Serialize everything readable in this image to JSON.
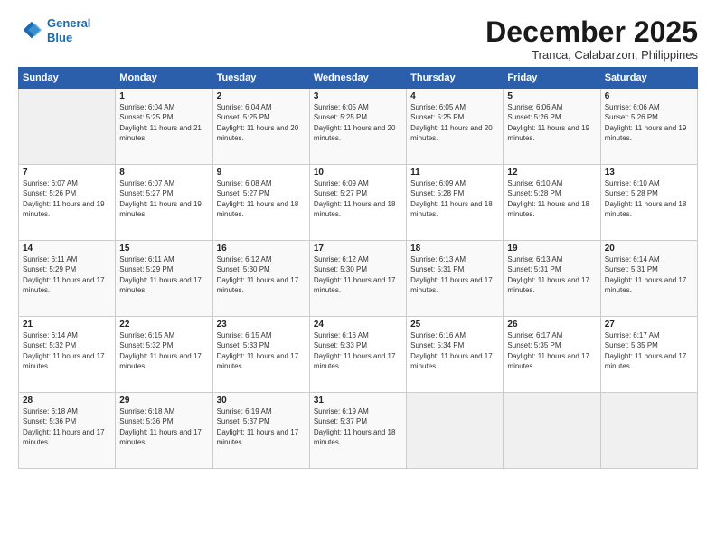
{
  "logo": {
    "line1": "General",
    "line2": "Blue"
  },
  "title": "December 2025",
  "subtitle": "Tranca, Calabarzon, Philippines",
  "header_days": [
    "Sunday",
    "Monday",
    "Tuesday",
    "Wednesday",
    "Thursday",
    "Friday",
    "Saturday"
  ],
  "weeks": [
    [
      {
        "num": "",
        "sunrise": "",
        "sunset": "",
        "daylight": "",
        "empty": true
      },
      {
        "num": "1",
        "sunrise": "Sunrise: 6:04 AM",
        "sunset": "Sunset: 5:25 PM",
        "daylight": "Daylight: 11 hours and 21 minutes."
      },
      {
        "num": "2",
        "sunrise": "Sunrise: 6:04 AM",
        "sunset": "Sunset: 5:25 PM",
        "daylight": "Daylight: 11 hours and 20 minutes."
      },
      {
        "num": "3",
        "sunrise": "Sunrise: 6:05 AM",
        "sunset": "Sunset: 5:25 PM",
        "daylight": "Daylight: 11 hours and 20 minutes."
      },
      {
        "num": "4",
        "sunrise": "Sunrise: 6:05 AM",
        "sunset": "Sunset: 5:25 PM",
        "daylight": "Daylight: 11 hours and 20 minutes."
      },
      {
        "num": "5",
        "sunrise": "Sunrise: 6:06 AM",
        "sunset": "Sunset: 5:26 PM",
        "daylight": "Daylight: 11 hours and 19 minutes."
      },
      {
        "num": "6",
        "sunrise": "Sunrise: 6:06 AM",
        "sunset": "Sunset: 5:26 PM",
        "daylight": "Daylight: 11 hours and 19 minutes."
      }
    ],
    [
      {
        "num": "7",
        "sunrise": "Sunrise: 6:07 AM",
        "sunset": "Sunset: 5:26 PM",
        "daylight": "Daylight: 11 hours and 19 minutes."
      },
      {
        "num": "8",
        "sunrise": "Sunrise: 6:07 AM",
        "sunset": "Sunset: 5:27 PM",
        "daylight": "Daylight: 11 hours and 19 minutes."
      },
      {
        "num": "9",
        "sunrise": "Sunrise: 6:08 AM",
        "sunset": "Sunset: 5:27 PM",
        "daylight": "Daylight: 11 hours and 18 minutes."
      },
      {
        "num": "10",
        "sunrise": "Sunrise: 6:09 AM",
        "sunset": "Sunset: 5:27 PM",
        "daylight": "Daylight: 11 hours and 18 minutes."
      },
      {
        "num": "11",
        "sunrise": "Sunrise: 6:09 AM",
        "sunset": "Sunset: 5:28 PM",
        "daylight": "Daylight: 11 hours and 18 minutes."
      },
      {
        "num": "12",
        "sunrise": "Sunrise: 6:10 AM",
        "sunset": "Sunset: 5:28 PM",
        "daylight": "Daylight: 11 hours and 18 minutes."
      },
      {
        "num": "13",
        "sunrise": "Sunrise: 6:10 AM",
        "sunset": "Sunset: 5:28 PM",
        "daylight": "Daylight: 11 hours and 18 minutes."
      }
    ],
    [
      {
        "num": "14",
        "sunrise": "Sunrise: 6:11 AM",
        "sunset": "Sunset: 5:29 PM",
        "daylight": "Daylight: 11 hours and 17 minutes."
      },
      {
        "num": "15",
        "sunrise": "Sunrise: 6:11 AM",
        "sunset": "Sunset: 5:29 PM",
        "daylight": "Daylight: 11 hours and 17 minutes."
      },
      {
        "num": "16",
        "sunrise": "Sunrise: 6:12 AM",
        "sunset": "Sunset: 5:30 PM",
        "daylight": "Daylight: 11 hours and 17 minutes."
      },
      {
        "num": "17",
        "sunrise": "Sunrise: 6:12 AM",
        "sunset": "Sunset: 5:30 PM",
        "daylight": "Daylight: 11 hours and 17 minutes."
      },
      {
        "num": "18",
        "sunrise": "Sunrise: 6:13 AM",
        "sunset": "Sunset: 5:31 PM",
        "daylight": "Daylight: 11 hours and 17 minutes."
      },
      {
        "num": "19",
        "sunrise": "Sunrise: 6:13 AM",
        "sunset": "Sunset: 5:31 PM",
        "daylight": "Daylight: 11 hours and 17 minutes."
      },
      {
        "num": "20",
        "sunrise": "Sunrise: 6:14 AM",
        "sunset": "Sunset: 5:31 PM",
        "daylight": "Daylight: 11 hours and 17 minutes."
      }
    ],
    [
      {
        "num": "21",
        "sunrise": "Sunrise: 6:14 AM",
        "sunset": "Sunset: 5:32 PM",
        "daylight": "Daylight: 11 hours and 17 minutes."
      },
      {
        "num": "22",
        "sunrise": "Sunrise: 6:15 AM",
        "sunset": "Sunset: 5:32 PM",
        "daylight": "Daylight: 11 hours and 17 minutes."
      },
      {
        "num": "23",
        "sunrise": "Sunrise: 6:15 AM",
        "sunset": "Sunset: 5:33 PM",
        "daylight": "Daylight: 11 hours and 17 minutes."
      },
      {
        "num": "24",
        "sunrise": "Sunrise: 6:16 AM",
        "sunset": "Sunset: 5:33 PM",
        "daylight": "Daylight: 11 hours and 17 minutes."
      },
      {
        "num": "25",
        "sunrise": "Sunrise: 6:16 AM",
        "sunset": "Sunset: 5:34 PM",
        "daylight": "Daylight: 11 hours and 17 minutes."
      },
      {
        "num": "26",
        "sunrise": "Sunrise: 6:17 AM",
        "sunset": "Sunset: 5:35 PM",
        "daylight": "Daylight: 11 hours and 17 minutes."
      },
      {
        "num": "27",
        "sunrise": "Sunrise: 6:17 AM",
        "sunset": "Sunset: 5:35 PM",
        "daylight": "Daylight: 11 hours and 17 minutes."
      }
    ],
    [
      {
        "num": "28",
        "sunrise": "Sunrise: 6:18 AM",
        "sunset": "Sunset: 5:36 PM",
        "daylight": "Daylight: 11 hours and 17 minutes."
      },
      {
        "num": "29",
        "sunrise": "Sunrise: 6:18 AM",
        "sunset": "Sunset: 5:36 PM",
        "daylight": "Daylight: 11 hours and 17 minutes."
      },
      {
        "num": "30",
        "sunrise": "Sunrise: 6:19 AM",
        "sunset": "Sunset: 5:37 PM",
        "daylight": "Daylight: 11 hours and 17 minutes."
      },
      {
        "num": "31",
        "sunrise": "Sunrise: 6:19 AM",
        "sunset": "Sunset: 5:37 PM",
        "daylight": "Daylight: 11 hours and 18 minutes."
      },
      {
        "num": "",
        "sunrise": "",
        "sunset": "",
        "daylight": "",
        "empty": true
      },
      {
        "num": "",
        "sunrise": "",
        "sunset": "",
        "daylight": "",
        "empty": true
      },
      {
        "num": "",
        "sunrise": "",
        "sunset": "",
        "daylight": "",
        "empty": true
      }
    ]
  ]
}
